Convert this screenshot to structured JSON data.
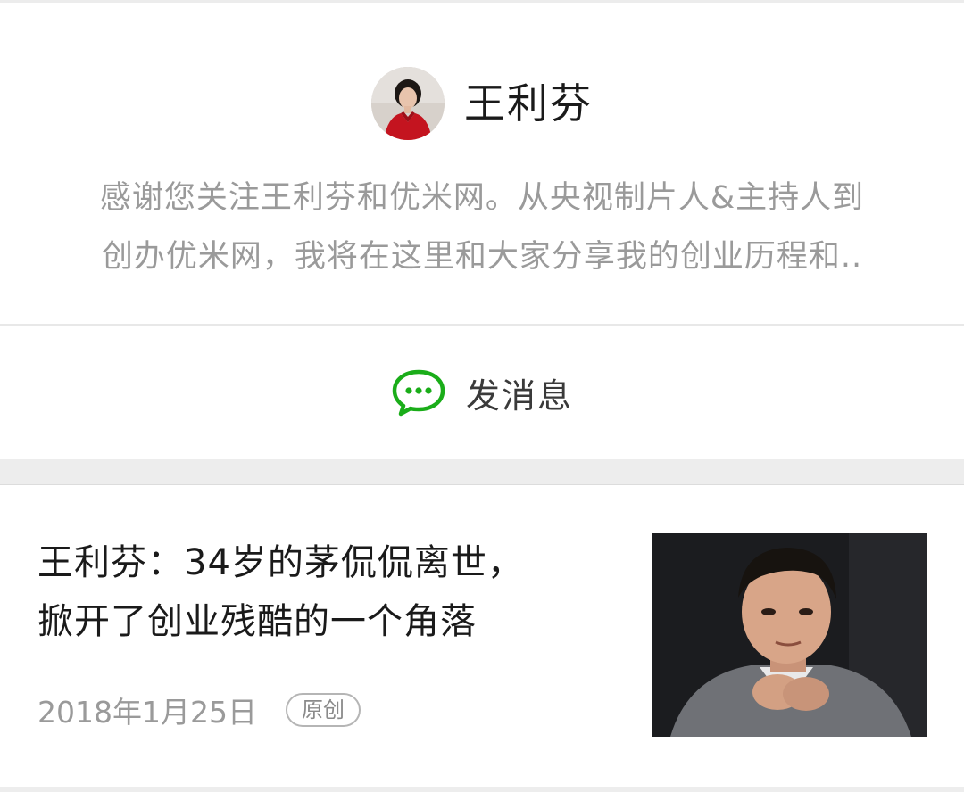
{
  "profile": {
    "name": "王利芬",
    "avatar_icon": "avatar-photo",
    "description_line1": "感谢您关注王利芬和优米网。从央视制片人&主持人到",
    "description_line2": "创办优米网，我将在这里和大家分享我的创业历程和.."
  },
  "message": {
    "label": "发消息",
    "icon": "chat-bubble-icon",
    "icon_color": "#1aad19"
  },
  "article": {
    "title_line1": "王利芬：34岁的茅侃侃离世，",
    "title_line2": "掀开了创业残酷的一个角落",
    "date": "2018年1月25日",
    "tag": "原创",
    "thumbnail_icon": "article-thumbnail-photo"
  }
}
